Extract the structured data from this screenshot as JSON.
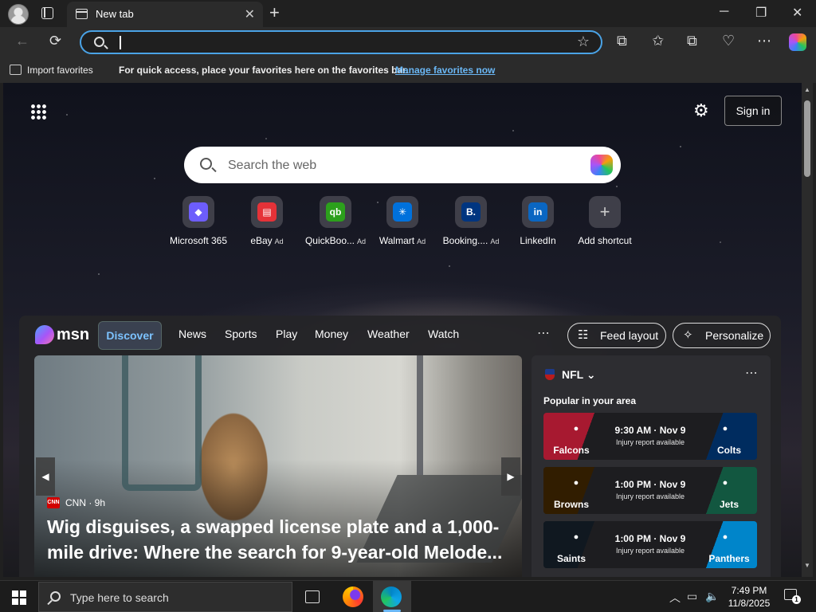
{
  "browser": {
    "tab_title": "New tab",
    "close_tab": "✕",
    "new_tab": "+",
    "window": {
      "minimize": "─",
      "maximize": "❐",
      "close": "✕"
    },
    "toolbar": {
      "back": "←",
      "refresh": "⟳",
      "star": "☆",
      "split": "⧉",
      "favorites": "✩",
      "collections": "⧉",
      "health": "♡",
      "more": "⋯"
    },
    "address_value": ""
  },
  "favorites_bar": {
    "import_label": "Import favorites",
    "message": "For quick access, place your favorites here on the favorites bar.",
    "manage_link": "Manage favorites now"
  },
  "newtab": {
    "search_placeholder": "Search the web",
    "sign_in": "Sign in",
    "settings": "⚙",
    "shortcuts": [
      {
        "label": "Microsoft 365",
        "ad": "",
        "glyph": "◆",
        "color": "#6d5dfc"
      },
      {
        "label": "eBay",
        "ad": "Ad",
        "glyph": "▤",
        "color": "#e53238"
      },
      {
        "label": "QuickBoo...",
        "ad": "Ad",
        "glyph": "qb",
        "color": "#2ca01c"
      },
      {
        "label": "Walmart",
        "ad": "Ad",
        "glyph": "✳",
        "color": "#0071dc"
      },
      {
        "label": "Booking....",
        "ad": "Ad",
        "glyph": "B.",
        "color": "#003580"
      },
      {
        "label": "LinkedIn",
        "ad": "",
        "glyph": "in",
        "color": "#0a66c2"
      },
      {
        "label": "Add shortcut",
        "ad": "",
        "glyph": "+",
        "color": "transparent"
      }
    ]
  },
  "msn": {
    "brand": "msn",
    "nav": [
      "Discover",
      "News",
      "Sports",
      "Play",
      "Money",
      "Weather",
      "Watch"
    ],
    "more": "⋯",
    "feed_layout": "Feed layout",
    "personalize": "Personalize",
    "hero": {
      "source": "CNN",
      "source_icon": "CNN",
      "age": "9h",
      "headline_line1": "Wig disguises, a swapped license plate and a 1,000-",
      "headline_line2": "mile drive: Where the search for 9-year-old Melode...",
      "prev": "◀",
      "next": "▶"
    },
    "nfl": {
      "title": "NFL",
      "chevron": "⌄",
      "more": "⋯",
      "popular": "Popular in your area",
      "games": [
        {
          "home": "Falcons",
          "away": "Colts",
          "time": "9:30 AM · Nov 9",
          "note": "Injury report available",
          "home_color": "#a71930",
          "away_color": "#002c5f"
        },
        {
          "home": "Browns",
          "away": "Jets",
          "time": "1:00 PM · Nov 9",
          "note": "Injury report available",
          "home_color": "#311d00",
          "away_color": "#125740"
        },
        {
          "home": "Saints",
          "away": "Panthers",
          "time": "1:00 PM · Nov 9",
          "note": "Injury report available",
          "home_color": "#101820",
          "away_color": "#0085ca"
        }
      ]
    }
  },
  "taskbar": {
    "search_placeholder": "Type here to search",
    "time": "7:49 PM",
    "date": "11/8/2025",
    "notifications_count": "1",
    "tray_chevron": "︿"
  }
}
